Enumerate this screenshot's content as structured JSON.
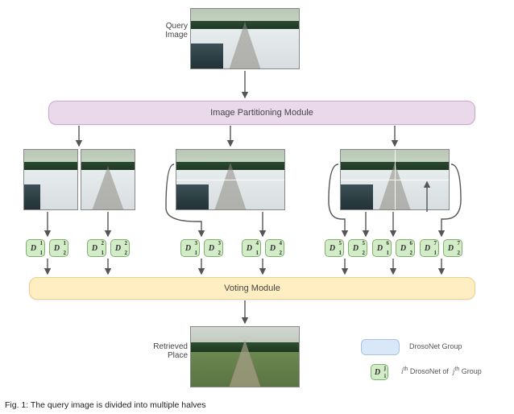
{
  "labels": {
    "query": "Query\nImage",
    "retrieved": "Retrieved\nPlace"
  },
  "modules": {
    "partition": "Image Partitioning Module",
    "voting": "Voting Module"
  },
  "d_groups": [
    [
      {
        "sub": "1",
        "sup": "1"
      },
      {
        "sub": "2",
        "sup": "1"
      }
    ],
    [
      {
        "sub": "1",
        "sup": "2"
      },
      {
        "sub": "2",
        "sup": "2"
      }
    ],
    [
      {
        "sub": "1",
        "sup": "3"
      },
      {
        "sub": "2",
        "sup": "3"
      }
    ],
    [
      {
        "sub": "1",
        "sup": "4"
      },
      {
        "sub": "2",
        "sup": "4"
      }
    ],
    [
      {
        "sub": "1",
        "sup": "5"
      },
      {
        "sub": "2",
        "sup": "5"
      }
    ],
    [
      {
        "sub": "1",
        "sup": "6"
      },
      {
        "sub": "2",
        "sup": "6"
      }
    ],
    [
      {
        "sub": "1",
        "sup": "7"
      },
      {
        "sub": "2",
        "sup": "7"
      }
    ]
  ],
  "legend": {
    "group": "DrosoNet Group",
    "item_prefix_html": "i<sup>th</sup> DrosoNet of  j<sup>th</sup> Group"
  },
  "caption_prefix": "Fig. 1:",
  "caption_rest": "  The query image is divided into multiple halves"
}
